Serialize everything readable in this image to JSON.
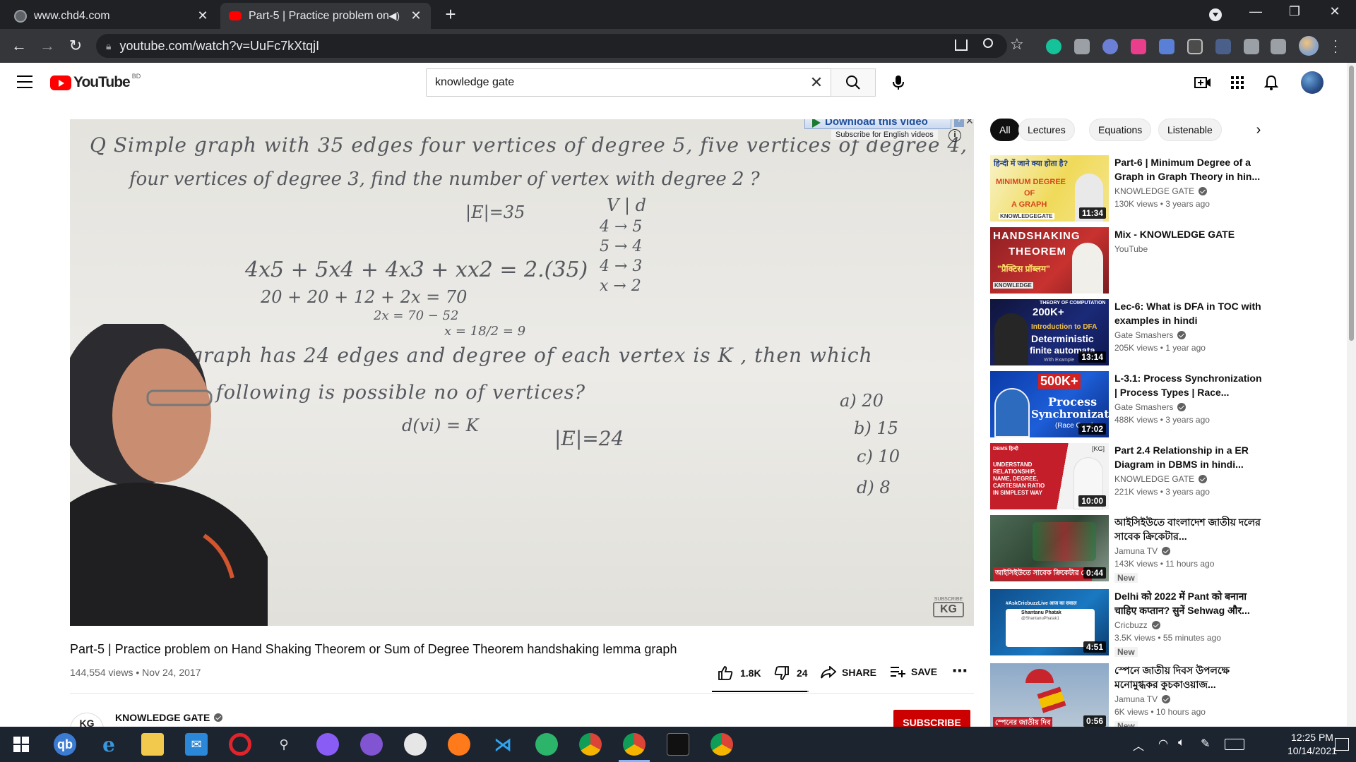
{
  "browser": {
    "tabs": [
      {
        "label": "www.chd4.com",
        "active": false
      },
      {
        "label": "Part-5 | Practice problem on",
        "active": true
      }
    ],
    "url": "youtube.com/watch?v=UuFc7kXtqjI"
  },
  "youtube": {
    "logo_text": "YouTube",
    "country_code": "BD",
    "search_value": "knowledge gate"
  },
  "player": {
    "board_lines": [
      "Q  Simple graph with 35 edges four vertices of degree 5, five vertices of degree 4,",
      "four vertices of degree 3, find the number of vertex with degree 2 ?",
      "|E|=35",
      "V | d",
      "4 → 5",
      "5 → 4",
      "4 → 3",
      "x → 2",
      "4x5 + 5x4 + 4x3 + xx2 = 2.(35)",
      "20 + 20 + 12 + 2x = 70",
      "2x = 70 − 52",
      "x = 18/2 = 9",
      "graph has 24 edges and degree of each vertex is K , then which",
      "the following is possible no of vertices?",
      "d(vi) = K",
      "|E|=24",
      "a) 20",
      "b) 15",
      "c) 10",
      "d) 8"
    ],
    "download_label": "Download this video",
    "download_sub": "Subscribe for English videos",
    "watermark_small": "SUBSCRIBE",
    "watermark": "KG"
  },
  "video": {
    "title": "Part-5 | Practice problem on Hand Shaking Theorem or Sum of Degree Theorem handshaking lemma graph",
    "meta": "144,554 views • Nov 24, 2017",
    "likes": "1.8K",
    "dislikes": "24",
    "share_label": "SHARE",
    "save_label": "SAVE",
    "like_ratio": 0.987,
    "channel": "KNOWLEDGE GATE",
    "channel_avatar": "KG",
    "subscribe_label": "SUBSCRIBE"
  },
  "chips": [
    "All",
    "Lectures",
    "Equations",
    "Listenable"
  ],
  "recommendations": [
    {
      "title": "Part-6 | Minimum Degree of a Graph in Graph Theory in hin...",
      "channel": "KNOWLEDGE GATE",
      "verified": true,
      "meta": "130K views • 3 years ago",
      "duration": "11:34",
      "thumb_text": [
        "हिन्दी में जाने क्या होता है?",
        "MINIMUM DEGREE",
        "OF",
        "A GRAPH",
        "KNOWLEDGEGATE"
      ]
    },
    {
      "title": "Mix - KNOWLEDGE GATE",
      "channel": "YouTube",
      "verified": false,
      "meta": "",
      "duration": "",
      "thumb_text": [
        "HANDSHAKING",
        "THEOREM",
        "\"प्रैक्टिस प्रॉब्लम\"",
        "KNOWLEDGE"
      ]
    },
    {
      "title": "Lec-6: What is DFA in TOC with examples in hindi",
      "channel": "Gate Smashers",
      "verified": true,
      "meta": "205K views • 1 year ago",
      "duration": "13:14",
      "thumb_text": [
        "THEORY OF COMPUTATION",
        "200K+",
        "Introduction to DFA",
        "Deterministic",
        "finite automata",
        "With Example"
      ]
    },
    {
      "title": "L-3.1: Process Synchronization | Process Types | Race...",
      "channel": "Gate Smashers",
      "verified": true,
      "meta": "488K views • 3 years ago",
      "duration": "17:02",
      "thumb_text": [
        "500K+",
        "Process",
        "Synchronization",
        "(Race Cond"
      ]
    },
    {
      "title": "Part 2.4 Relationship in a ER Diagram in DBMS in hindi...",
      "channel": "KNOWLEDGE GATE",
      "verified": true,
      "meta": "221K views • 3 years ago",
      "duration": "10:00",
      "thumb_text": [
        "DBMS हिन्दी",
        "UNDERSTAND",
        "RELATIONSHIP,",
        "NAME, DEGREE,",
        "CARTESIAN RATIO",
        "IN SIMPLEST WAY",
        "[KG]"
      ]
    },
    {
      "title": "আইসিইউতে বাংলাদেশ জাতীয় দলের সাবেক ক্রিকেটার...",
      "channel": "Jamuna TV",
      "verified": true,
      "meta": "143K views • 11 hours ago",
      "duration": "0:44",
      "badge": "New",
      "thumb_text": [
        "আইসিইউতে সাবেক ক্রিকেটার মো"
      ]
    },
    {
      "title": "Delhi को 2022 में Pant को बनाना चाहिए कप्तान? सुनें Sehwag और...",
      "channel": "Cricbuzz",
      "verified": true,
      "meta": "3.5K views • 55 minutes ago",
      "duration": "4:51",
      "badge": "New",
      "thumb_text": [
        "#AskCricbuzzLive आज का सवाल",
        "Shantanu Phatak",
        "@ShantanuPhatak1"
      ]
    },
    {
      "title": "স্পেনে জাতীয় দিবস উপলক্ষে মনোমুগ্ধকর কুচকাওয়াজ...",
      "channel": "Jamuna TV",
      "verified": true,
      "meta": "6K views • 10 hours ago",
      "duration": "0:56",
      "badge": "New",
      "thumb_text": [
        "স্পেনের জাতীয় দিব"
      ]
    }
  ],
  "taskbar": {
    "time": "12:25 PM",
    "date": "10/14/2021"
  }
}
